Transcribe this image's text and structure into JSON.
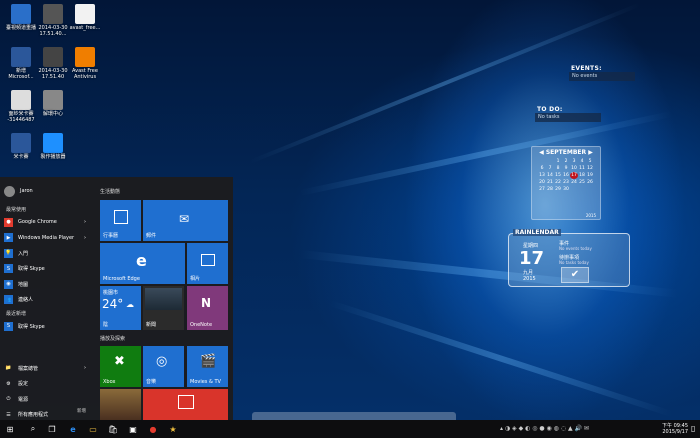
{
  "desktop_icons": [
    {
      "label": "臺視頻道重播",
      "color": "#2a6fc9",
      "col": 0,
      "row": 0
    },
    {
      "label": "2014-03-30\n17.51.40...",
      "color": "#555",
      "col": 1,
      "row": 0
    },
    {
      "label": "avast_free...",
      "color": "#f2f2f2",
      "col": 2,
      "row": 0
    },
    {
      "label": "新增\nMicrosof...",
      "color": "#2b579a",
      "col": 0,
      "row": 1
    },
    {
      "label": "2014-03-30\n17.51.40",
      "color": "#444",
      "col": 1,
      "row": 1
    },
    {
      "label": "Avast Free\nAntivirus",
      "color": "#f07e00",
      "col": 2,
      "row": 1
    },
    {
      "label": "面紗米卡賽\n-31446487",
      "color": "#ddd",
      "col": 0,
      "row": 2
    },
    {
      "label": "解環中心",
      "color": "#888",
      "col": 1,
      "row": 2
    },
    {
      "label": "米卡賽",
      "color": "#2b579a",
      "col": 0,
      "row": 3
    },
    {
      "label": "製作播放器",
      "color": "#1e90ff",
      "col": 1,
      "row": 3
    }
  ],
  "widgets": {
    "events_title": "EVENTS:",
    "events_text": "No events",
    "todo_title": "TO DO:",
    "todo_text": "No tasks",
    "calendar": {
      "month": "SEPTEMBER",
      "year": "2015",
      "weeks": [
        [
          "",
          "",
          "1",
          "2",
          "3",
          "4",
          "5"
        ],
        [
          "6",
          "7",
          "8",
          "9",
          "10",
          "11",
          "12"
        ],
        [
          "13",
          "14",
          "15",
          "16",
          "17",
          "18",
          "19"
        ],
        [
          "20",
          "21",
          "22",
          "23",
          "24",
          "25",
          "26"
        ],
        [
          "27",
          "28",
          "29",
          "30",
          "",
          "",
          ""
        ]
      ],
      "today": "17"
    },
    "rainlendar": {
      "title": "RAINLENDAR",
      "weekday": "星期四",
      "day": "17",
      "month": "九月",
      "year": "2015",
      "events_label": "事件",
      "events_text": "No events today",
      "todo_label": "待辦事項",
      "todo_text": "No tasks today"
    }
  },
  "start_menu": {
    "user": "Jaron",
    "most_used_header": "最常使用",
    "most_used": [
      {
        "label": "Google Chrome",
        "color": "#e33b2e",
        "glyph": "●"
      },
      {
        "label": "Windows Media Player",
        "color": "#1f6fd0",
        "glyph": "▶"
      },
      {
        "label": "入門",
        "color": "#1f6fd0",
        "glyph": "💡"
      },
      {
        "label": "取得 Skype",
        "color": "#1f6fd0",
        "glyph": "S"
      },
      {
        "label": "地圖",
        "color": "#1f6fd0",
        "glyph": "◉"
      },
      {
        "label": "連絡人",
        "color": "#1f6fd0",
        "glyph": "👥"
      }
    ],
    "recent_header": "最近新增",
    "recent": [
      {
        "label": "取得 Skype",
        "color": "#1f6fd0",
        "glyph": "S"
      }
    ],
    "bottom": [
      {
        "label": "檔案總管",
        "glyph": "📁"
      },
      {
        "label": "設定",
        "glyph": "⚙"
      },
      {
        "label": "電源",
        "glyph": "⏻"
      },
      {
        "label": "所有應用程式",
        "glyph": "☰"
      }
    ],
    "new_badge": "新增",
    "life_header": "生活動態",
    "play_header": "播放及探索",
    "tiles": {
      "calendar": "行事曆",
      "mail": "郵件",
      "edge": "Microsoft Edge",
      "photos": "相片",
      "weather_city": "桃園市",
      "weather_temp": "24°",
      "weather_condition": "陰",
      "news_label": "新聞",
      "onenote": "OneNote",
      "xbox": "Xbox",
      "music": "音樂",
      "movies": "Movies & TV"
    }
  },
  "taskbar": {
    "time": "下午 09:45",
    "date": "2015/9/17"
  }
}
